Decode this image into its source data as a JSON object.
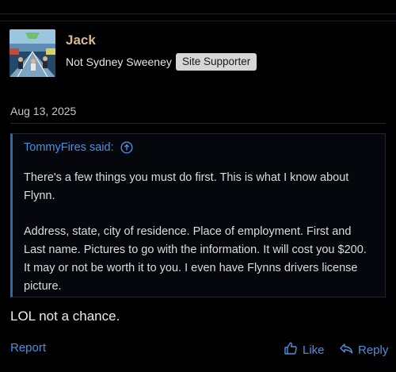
{
  "post": {
    "author": "Jack",
    "author_title": "Not Sydney Sweeney",
    "badge": "Site Supporter",
    "date": "Aug 13, 2025",
    "body": "LOL not a chance."
  },
  "quote": {
    "header": "TommyFires said:",
    "paragraphs": [
      "There's a few things you must do first. This is what I know about Flynn.",
      "Address, state, city of residence. Place of employment. First and Last name. Pictures to go with the information. It will cost you $200. It may or not be worth it to you. I even have Flynns drivers license picture."
    ]
  },
  "actions": {
    "report": "Report",
    "like": "Like",
    "reply": "Reply"
  },
  "colors": {
    "background": "#000000",
    "link": "#4d8fe0",
    "username": "#d8b98e",
    "quote_border": "#2f66b8"
  }
}
